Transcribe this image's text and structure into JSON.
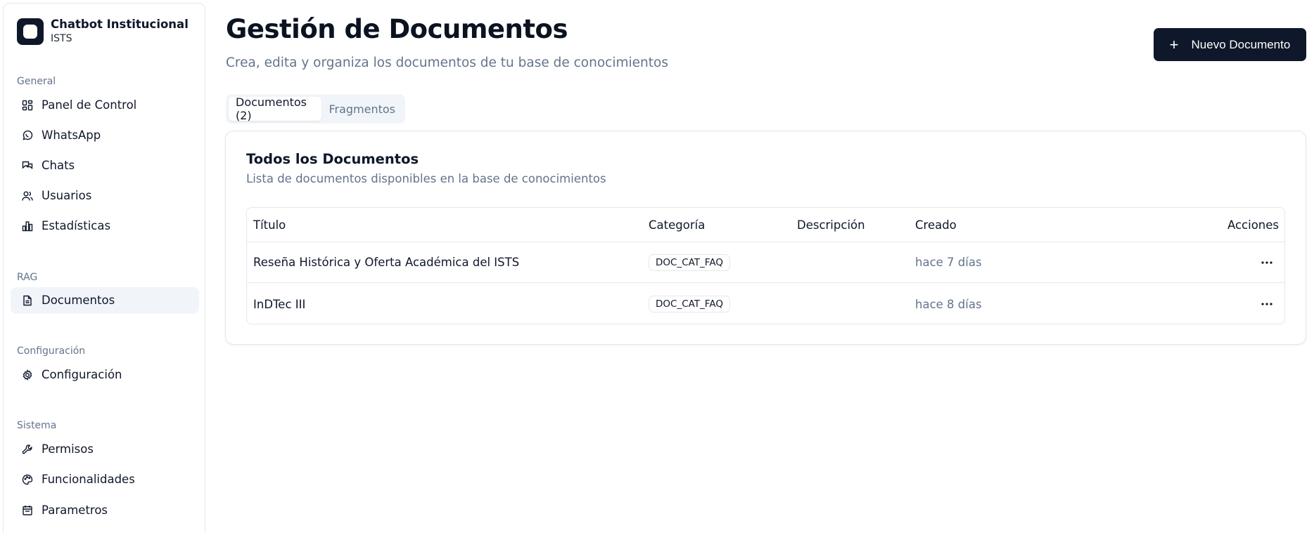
{
  "sidebar": {
    "brand_title": "Chatbot Institucional",
    "brand_sub": "ISTS",
    "groups": [
      {
        "label": "General",
        "items": [
          {
            "label": "Panel de Control",
            "icon": "dashboard-icon"
          },
          {
            "label": "WhatsApp",
            "icon": "whatsapp-icon"
          },
          {
            "label": "Chats",
            "icon": "chats-icon"
          },
          {
            "label": "Usuarios",
            "icon": "users-icon"
          },
          {
            "label": "Estadísticas",
            "icon": "bar-chart-icon"
          }
        ]
      },
      {
        "label": "RAG",
        "items": [
          {
            "label": "Documentos",
            "icon": "document-icon",
            "active": true
          }
        ]
      },
      {
        "label": "Configuración",
        "items": [
          {
            "label": "Configuración",
            "icon": "gear-icon"
          }
        ]
      },
      {
        "label": "Sistema",
        "items": [
          {
            "label": "Permisos",
            "icon": "wrench-icon"
          },
          {
            "label": "Funcionalidades",
            "icon": "palette-icon"
          },
          {
            "label": "Parametros",
            "icon": "calendar-icon"
          }
        ]
      }
    ]
  },
  "header": {
    "title": "Gestión de Documentos",
    "subtitle": "Crea, edita y organiza los documentos de tu base de conocimientos",
    "new_button": "Nuevo Documento"
  },
  "tabs": [
    {
      "label": "Documentos (2)",
      "active": true
    },
    {
      "label": "Fragmentos",
      "active": false
    }
  ],
  "card": {
    "title": "Todos los Documentos",
    "subtitle": "Lista de documentos disponibles en la base de conocimientos"
  },
  "table": {
    "headers": {
      "title": "Título",
      "category": "Categoría",
      "description": "Descripción",
      "created": "Creado",
      "actions": "Acciones"
    },
    "rows": [
      {
        "title": "Reseña Histórica y Oferta Académica del ISTS",
        "category": "DOC_CAT_FAQ",
        "description": "",
        "created": "hace 7 días"
      },
      {
        "title": "InDTec III",
        "category": "DOC_CAT_FAQ",
        "description": "",
        "created": "hace 8 días"
      }
    ]
  },
  "colors": {
    "primary": "#0f172a",
    "muted": "#64748b",
    "border": "#e5e7eb",
    "active_bg": "#f1f5f9"
  }
}
